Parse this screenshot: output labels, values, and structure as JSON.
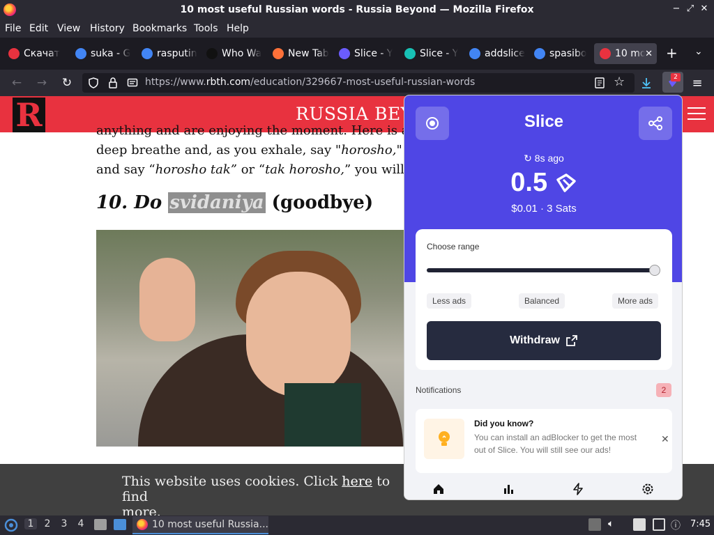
{
  "window": {
    "title": "10 most useful Russian words - Russia Beyond — Mozilla Firefox",
    "controls": [
      "−",
      "⤢",
      "✕"
    ]
  },
  "menu": [
    "File",
    "Edit",
    "View",
    "History",
    "Bookmarks",
    "Tools",
    "Help"
  ],
  "tabs": [
    {
      "label": "Скачат",
      "icon": "yandex-icon",
      "color": "#e8323f"
    },
    {
      "label": "suka - G",
      "icon": "google-icon",
      "color": "#4285f4"
    },
    {
      "label": "rasputin",
      "icon": "google-icon",
      "color": "#4285f4"
    },
    {
      "label": "Who Wa",
      "icon": "amazon-icon",
      "color": "#111111"
    },
    {
      "label": "New Tab",
      "icon": "firefox-icon",
      "color": "#ff7139"
    },
    {
      "label": "Slice - Y",
      "icon": "slice-icon",
      "color": "#6b5cff"
    },
    {
      "label": "Slice - Y",
      "icon": "slice-teal-icon",
      "color": "#18c1b5"
    },
    {
      "label": "addslice",
      "icon": "google-icon",
      "color": "#4285f4"
    },
    {
      "label": "spasibo",
      "icon": "google-icon",
      "color": "#4285f4"
    },
    {
      "label": "10 mo",
      "icon": "russia-beyond-icon",
      "color": "#e8323f",
      "active": true
    }
  ],
  "url": {
    "prefix": "https://www.",
    "domain": "rbth.com",
    "path": "/education/329667-most-useful-russian-words"
  },
  "extension_badge": "2",
  "site": {
    "logo": "R",
    "name": "RUSSIA BEYOND"
  },
  "article": {
    "line1": "anything and are enjoying the moment. Here is an ex",
    "line2_a": "deep breathe and, as you exhale, say \"",
    "line2_em": "horosho,",
    "line2_b": "\" slow",
    "line3_a": "and say “",
    "line3_em1": "horosho tak”",
    "line3_b": " or  “",
    "line3_em2": "tak horosho,",
    "line3_c": "” you will sour",
    "heading_num": "10. Do ",
    "heading_hl": "svidaniya",
    "heading_rest": " (goodbye)"
  },
  "cookie": {
    "text_a": "This website uses cookies. Click ",
    "link": "here",
    "text_b": " to find",
    "text_c": "more."
  },
  "slice": {
    "title": "Slice",
    "updated": "8s ago",
    "amount": "0.5",
    "usd": "$0.01 ·  3 Sats",
    "range_label": "Choose range",
    "range_value": 1.0,
    "range_options": [
      "Less ads",
      "Balanced",
      "More ads"
    ],
    "withdraw": "Withdraw",
    "notifications_label": "Notifications",
    "notifications_count": "2",
    "notification": {
      "title": "Did you know?",
      "body": "You can install an adBlocker to get the most out of Slice. You will still see our ads!"
    },
    "accent": "#4f46e5"
  },
  "taskbar": {
    "workspaces": [
      "1",
      "2",
      "3",
      "4"
    ],
    "active_window": "10 most useful Russia...",
    "clock": "7:45"
  }
}
